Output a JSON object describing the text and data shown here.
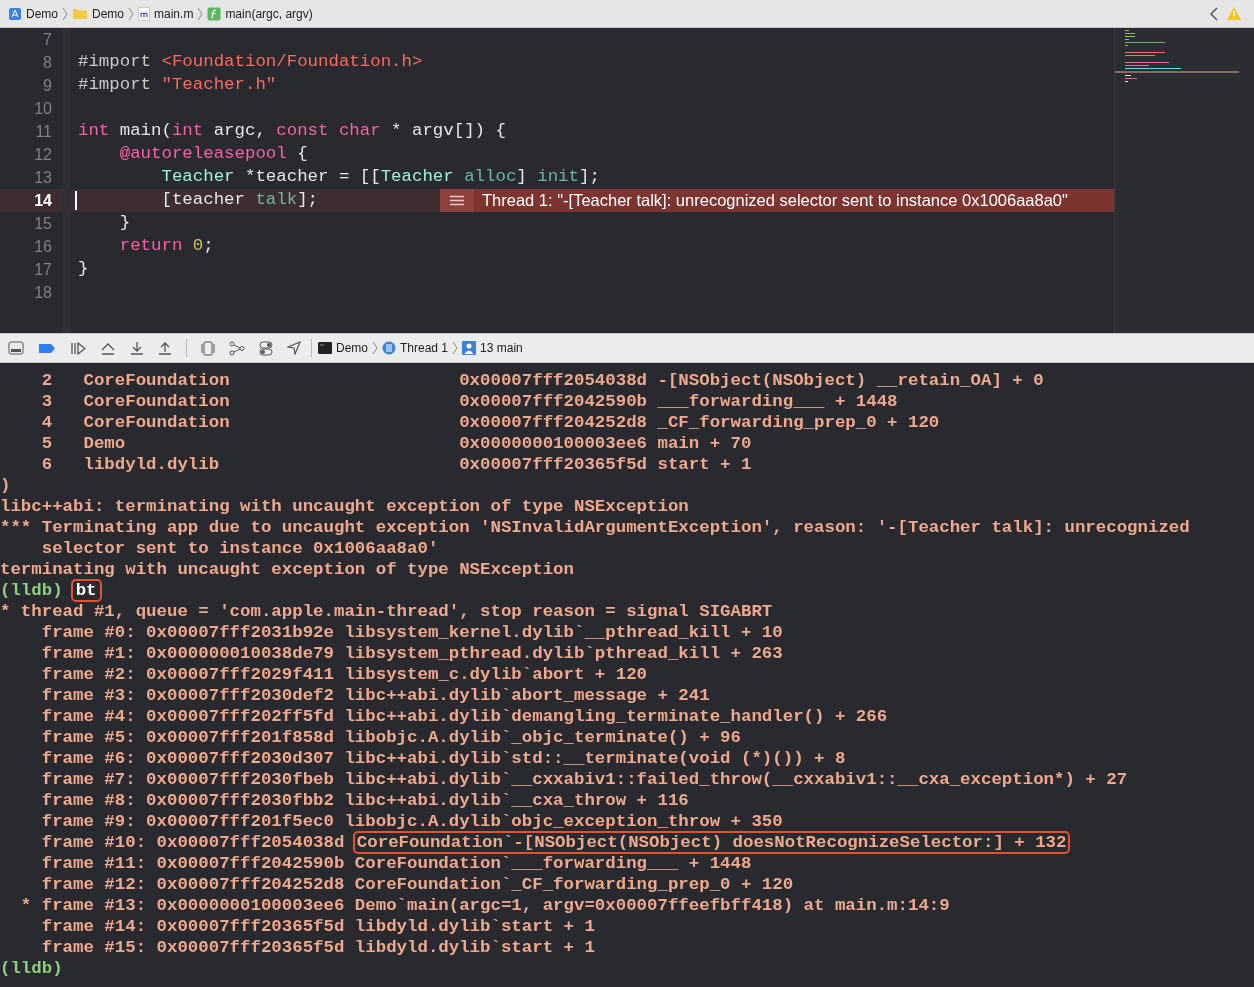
{
  "breadcrumb": [
    {
      "label": "Demo",
      "kind": "app"
    },
    {
      "label": "Demo",
      "kind": "folder"
    },
    {
      "label": "main.m",
      "kind": "file"
    },
    {
      "label": "main(argc, argv)",
      "kind": "function"
    }
  ],
  "editor": {
    "lines": [
      {
        "number": "7",
        "current": false
      },
      {
        "number": "8",
        "current": false,
        "tokens": [
          {
            "text": "#import ",
            "kind": "directive"
          },
          {
            "text": "<Foundation/Foundation.h>",
            "kind": "string"
          }
        ]
      },
      {
        "number": "9",
        "current": false,
        "tokens": [
          {
            "text": "#import ",
            "kind": "directive"
          },
          {
            "text": "\"Teacher.h\"",
            "kind": "string"
          }
        ]
      },
      {
        "number": "10",
        "current": false
      },
      {
        "number": "11",
        "current": false,
        "tokens": [
          {
            "text": "int",
            "kind": "keyword"
          },
          {
            "text": " main(",
            "kind": "plain"
          },
          {
            "text": "int",
            "kind": "keyword"
          },
          {
            "text": " argc, ",
            "kind": "plain"
          },
          {
            "text": "const",
            "kind": "keyword"
          },
          {
            "text": " char",
            "kind": "keyword"
          },
          {
            "text": " * argv[]) {",
            "kind": "plain"
          }
        ]
      },
      {
        "number": "12",
        "current": false,
        "tokens": [
          {
            "text": "    @autoreleasepool",
            "kind": "keyword"
          },
          {
            "text": " {",
            "kind": "plain"
          }
        ]
      },
      {
        "number": "13",
        "current": false,
        "tokens": [
          {
            "text": "        Teacher",
            "kind": "type"
          },
          {
            "text": " *teacher = [[",
            "kind": "plain"
          },
          {
            "text": "Teacher",
            "kind": "type"
          },
          {
            "text": " alloc",
            "kind": "method"
          },
          {
            "text": "] ",
            "kind": "plain"
          },
          {
            "text": "init",
            "kind": "method"
          },
          {
            "text": "];",
            "kind": "plain"
          }
        ]
      },
      {
        "number": "14",
        "current": true,
        "tokens": [
          {
            "text": "        [teacher ",
            "kind": "plain"
          },
          {
            "text": "talk",
            "kind": "method"
          },
          {
            "text": "];",
            "kind": "plain"
          }
        ],
        "error": "Thread 1: \"-[Teacher talk]: unrecognized selector sent to instance 0x1006aa8a0\""
      },
      {
        "number": "15",
        "current": false,
        "tokens": [
          {
            "text": "    }",
            "kind": "plain"
          }
        ]
      },
      {
        "number": "16",
        "current": false,
        "tokens": [
          {
            "text": "    return",
            "kind": "keyword"
          },
          {
            "text": " 0",
            "kind": "number"
          },
          {
            "text": ";",
            "kind": "plain"
          }
        ]
      },
      {
        "number": "17",
        "current": false,
        "tokens": [
          {
            "text": "}",
            "kind": "plain"
          }
        ]
      },
      {
        "number": "18",
        "current": false
      }
    ]
  },
  "debug_bar": {
    "breakpoints_active": true,
    "path": [
      {
        "label": "Demo",
        "kind": "process"
      },
      {
        "label": "Thread 1",
        "kind": "thread"
      },
      {
        "label": "13 main",
        "kind": "frame"
      }
    ]
  },
  "console": [
    [
      {
        "text": "    2   CoreFoundation                      0x00007fff2054038d -[NSObject(NSObject) __retain_OA] + 0",
        "kind": "output"
      }
    ],
    [
      {
        "text": "    3   CoreFoundation                      0x00007fff2042590b ___forwarding___ + 1448",
        "kind": "output"
      }
    ],
    [
      {
        "text": "    4   CoreFoundation                      0x00007fff204252d8 _CF_forwarding_prep_0 + 120",
        "kind": "output"
      }
    ],
    [
      {
        "text": "    5   Demo                                0x0000000100003ee6 main + 70",
        "kind": "output"
      }
    ],
    [
      {
        "text": "    6   libdyld.dylib                       0x00007fff20365f5d start + 1",
        "kind": "output"
      }
    ],
    [
      {
        "text": ")",
        "kind": "output"
      }
    ],
    [
      {
        "text": "libc++abi: terminating with uncaught exception of type NSException",
        "kind": "output"
      }
    ],
    [
      {
        "text": "*** Terminating app due to uncaught exception 'NSInvalidArgumentException', reason: '-[Teacher talk]: unrecognized",
        "kind": "output"
      }
    ],
    [
      {
        "text": "    selector sent to instance 0x1006aa8a0'",
        "kind": "output"
      }
    ],
    [
      {
        "text": "terminating with uncaught exception of type NSException",
        "kind": "output"
      }
    ],
    [
      {
        "text": "(lldb)",
        "kind": "prompt"
      },
      {
        "text": "bt",
        "kind": "command"
      }
    ],
    [
      {
        "text": "* thread #1, queue = 'com.apple.main-thread', stop reason = signal SIGABRT",
        "kind": "output"
      }
    ],
    [
      {
        "text": "    frame #0: 0x00007fff2031b92e libsystem_kernel.dylib`__pthread_kill + 10",
        "kind": "output"
      }
    ],
    [
      {
        "text": "    frame #1: 0x000000010038de79 libsystem_pthread.dylib`pthread_kill + 263",
        "kind": "output"
      }
    ],
    [
      {
        "text": "    frame #2: 0x00007fff2029f411 libsystem_c.dylib`abort + 120",
        "kind": "output"
      }
    ],
    [
      {
        "text": "    frame #3: 0x00007fff2030def2 libc++abi.dylib`abort_message + 241",
        "kind": "output"
      }
    ],
    [
      {
        "text": "    frame #4: 0x00007fff202ff5fd libc++abi.dylib`demangling_terminate_handler() + 266",
        "kind": "output"
      }
    ],
    [
      {
        "text": "    frame #5: 0x00007fff201f858d libobjc.A.dylib`_objc_terminate() + 96",
        "kind": "output"
      }
    ],
    [
      {
        "text": "    frame #6: 0x00007fff2030d307 libc++abi.dylib`std::__terminate(void (*)()) + 8",
        "kind": "output"
      }
    ],
    [
      {
        "text": "    frame #7: 0x00007fff2030fbeb libc++abi.dylib`__cxxabiv1::failed_throw(__cxxabiv1::__cxa_exception*) + 27",
        "kind": "output"
      }
    ],
    [
      {
        "text": "    frame #8: 0x00007fff2030fbb2 libc++abi.dylib`__cxa_throw + 116",
        "kind": "output"
      }
    ],
    [
      {
        "text": "    frame #9: 0x00007fff201f5ec0 libobjc.A.dylib`objc_exception_throw + 350",
        "kind": "output"
      }
    ],
    [
      {
        "text": "    frame #10: 0x00007fff2054038d ",
        "kind": "output"
      },
      {
        "text": "CoreFoundation`-[NSObject(NSObject) doesNotRecognizeSelector:] + 132",
        "kind": "highlight"
      }
    ],
    [
      {
        "text": "    frame #11: 0x00007fff2042590b CoreFoundation`___forwarding___ + 1448",
        "kind": "output"
      }
    ],
    [
      {
        "text": "    frame #12: 0x00007fff204252d8 CoreFoundation`_CF_forwarding_prep_0 + 120",
        "kind": "output"
      }
    ],
    [
      {
        "text": "  * frame #13: 0x0000000100003ee6 Demo`main(argc=1, argv=0x00007ffeefbff418) at main.m:14:9",
        "kind": "output"
      }
    ],
    [
      {
        "text": "    frame #14: 0x00007fff20365f5d libdyld.dylib`start + 1",
        "kind": "output"
      }
    ],
    [
      {
        "text": "    frame #15: 0x00007fff20365f5d libdyld.dylib`start + 1",
        "kind": "output"
      }
    ],
    [
      {
        "text": "(lldb)",
        "kind": "prompt"
      }
    ]
  ]
}
